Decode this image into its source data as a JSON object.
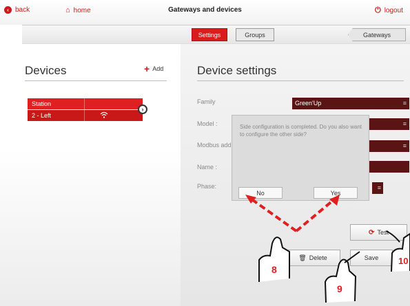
{
  "header": {
    "back_label": "back",
    "home_label": "home",
    "title": "Gateways and devices",
    "logout_label": "logout"
  },
  "tabs": {
    "settings": "Settings",
    "groups": "Groups",
    "gateways": "Gateways"
  },
  "devices": {
    "title": "Devices",
    "add_label": "Add",
    "rows": [
      "Station",
      "2 - Left"
    ]
  },
  "settings": {
    "title": "Device settings",
    "fields": [
      {
        "label": "Family",
        "value": "Green'Up"
      },
      {
        "label": "Model :",
        "value": ""
      },
      {
        "label": "Modbus add",
        "value": ""
      },
      {
        "label": "Name :",
        "value": ""
      },
      {
        "label": "Phase:",
        "value": ""
      }
    ]
  },
  "modal": {
    "message": "Side configuration is completed. Do you also want to configure the other side?",
    "no_label": "No",
    "yes_label": "Yes"
  },
  "actions": {
    "test_label": "Test",
    "delete_label": "Delete",
    "save_label": "Save"
  },
  "callouts": [
    "8",
    "9",
    "10"
  ],
  "colors": {
    "accent": "#d81d1d",
    "field_bg": "#5a1414",
    "callout": "#e02020"
  }
}
